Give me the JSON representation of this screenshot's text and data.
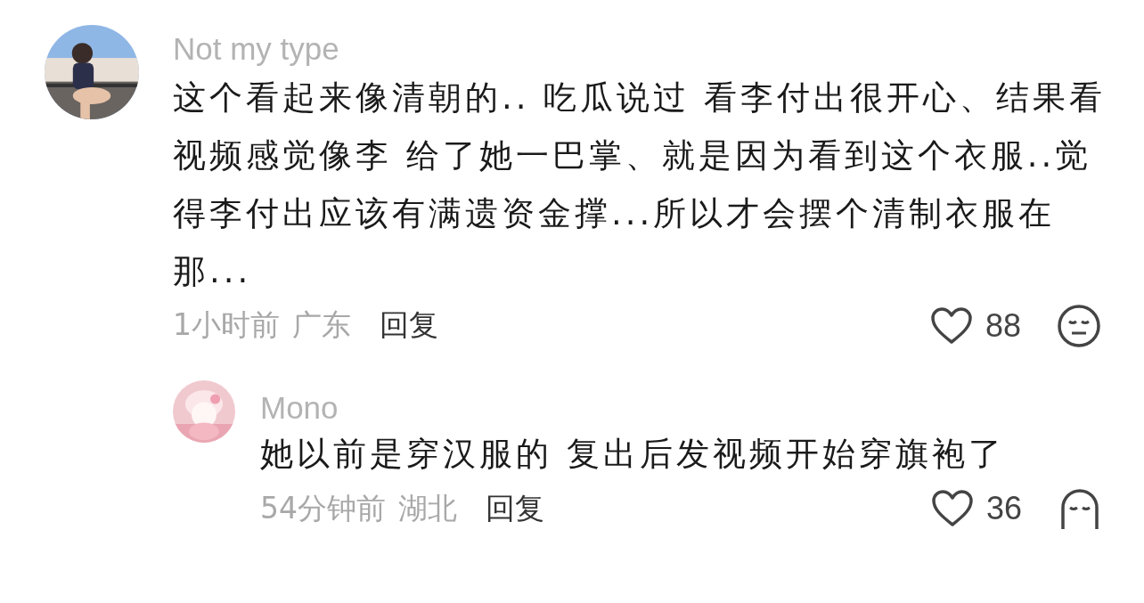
{
  "comments": [
    {
      "name": "Not my type",
      "text": "这个看起来像清朝的.. 吃瓜说过 看李付出很开心、结果看视频感觉像李 给了她一巴掌、就是因为看到这个衣服..觉得李付出应该有满遗资金撑...所以才会摆个清制衣服在那...",
      "time": "1小时前",
      "location": "广东",
      "reply_label": "回复",
      "likes": "88",
      "replies": [
        {
          "name": "Mono",
          "text": "她以前是穿汉服的 复出后发视频开始穿旗袍了",
          "time": "54分钟前",
          "location": "湖北",
          "reply_label": "回复",
          "likes": "36"
        }
      ]
    }
  ]
}
